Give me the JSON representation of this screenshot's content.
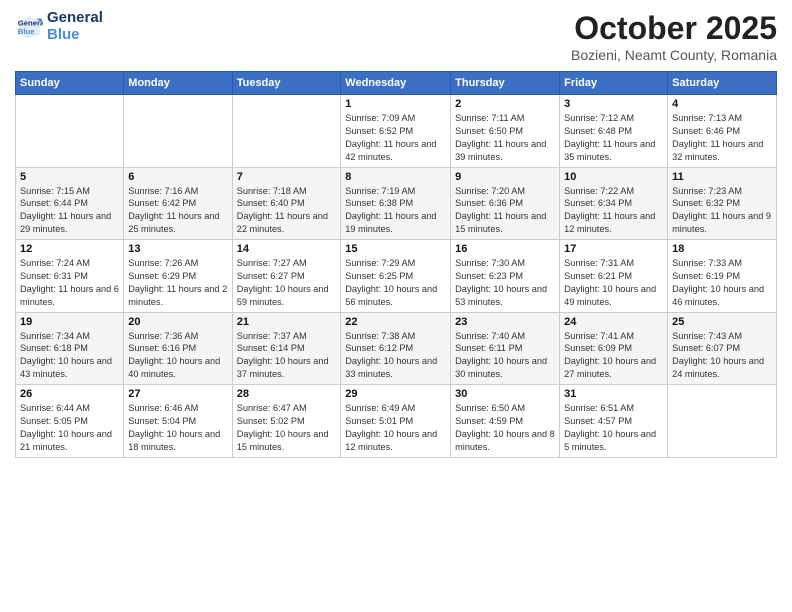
{
  "logo": {
    "line1": "General",
    "line2": "Blue"
  },
  "title": "October 2025",
  "subtitle": "Bozieni, Neamt County, Romania",
  "days_of_week": [
    "Sunday",
    "Monday",
    "Tuesday",
    "Wednesday",
    "Thursday",
    "Friday",
    "Saturday"
  ],
  "weeks": [
    [
      {
        "day": "",
        "sunrise": "",
        "sunset": "",
        "daylight": ""
      },
      {
        "day": "",
        "sunrise": "",
        "sunset": "",
        "daylight": ""
      },
      {
        "day": "",
        "sunrise": "",
        "sunset": "",
        "daylight": ""
      },
      {
        "day": "1",
        "sunrise": "Sunrise: 7:09 AM",
        "sunset": "Sunset: 6:52 PM",
        "daylight": "Daylight: 11 hours and 42 minutes."
      },
      {
        "day": "2",
        "sunrise": "Sunrise: 7:11 AM",
        "sunset": "Sunset: 6:50 PM",
        "daylight": "Daylight: 11 hours and 39 minutes."
      },
      {
        "day": "3",
        "sunrise": "Sunrise: 7:12 AM",
        "sunset": "Sunset: 6:48 PM",
        "daylight": "Daylight: 11 hours and 35 minutes."
      },
      {
        "day": "4",
        "sunrise": "Sunrise: 7:13 AM",
        "sunset": "Sunset: 6:46 PM",
        "daylight": "Daylight: 11 hours and 32 minutes."
      }
    ],
    [
      {
        "day": "5",
        "sunrise": "Sunrise: 7:15 AM",
        "sunset": "Sunset: 6:44 PM",
        "daylight": "Daylight: 11 hours and 29 minutes."
      },
      {
        "day": "6",
        "sunrise": "Sunrise: 7:16 AM",
        "sunset": "Sunset: 6:42 PM",
        "daylight": "Daylight: 11 hours and 25 minutes."
      },
      {
        "day": "7",
        "sunrise": "Sunrise: 7:18 AM",
        "sunset": "Sunset: 6:40 PM",
        "daylight": "Daylight: 11 hours and 22 minutes."
      },
      {
        "day": "8",
        "sunrise": "Sunrise: 7:19 AM",
        "sunset": "Sunset: 6:38 PM",
        "daylight": "Daylight: 11 hours and 19 minutes."
      },
      {
        "day": "9",
        "sunrise": "Sunrise: 7:20 AM",
        "sunset": "Sunset: 6:36 PM",
        "daylight": "Daylight: 11 hours and 15 minutes."
      },
      {
        "day": "10",
        "sunrise": "Sunrise: 7:22 AM",
        "sunset": "Sunset: 6:34 PM",
        "daylight": "Daylight: 11 hours and 12 minutes."
      },
      {
        "day": "11",
        "sunrise": "Sunrise: 7:23 AM",
        "sunset": "Sunset: 6:32 PM",
        "daylight": "Daylight: 11 hours and 9 minutes."
      }
    ],
    [
      {
        "day": "12",
        "sunrise": "Sunrise: 7:24 AM",
        "sunset": "Sunset: 6:31 PM",
        "daylight": "Daylight: 11 hours and 6 minutes."
      },
      {
        "day": "13",
        "sunrise": "Sunrise: 7:26 AM",
        "sunset": "Sunset: 6:29 PM",
        "daylight": "Daylight: 11 hours and 2 minutes."
      },
      {
        "day": "14",
        "sunrise": "Sunrise: 7:27 AM",
        "sunset": "Sunset: 6:27 PM",
        "daylight": "Daylight: 10 hours and 59 minutes."
      },
      {
        "day": "15",
        "sunrise": "Sunrise: 7:29 AM",
        "sunset": "Sunset: 6:25 PM",
        "daylight": "Daylight: 10 hours and 56 minutes."
      },
      {
        "day": "16",
        "sunrise": "Sunrise: 7:30 AM",
        "sunset": "Sunset: 6:23 PM",
        "daylight": "Daylight: 10 hours and 53 minutes."
      },
      {
        "day": "17",
        "sunrise": "Sunrise: 7:31 AM",
        "sunset": "Sunset: 6:21 PM",
        "daylight": "Daylight: 10 hours and 49 minutes."
      },
      {
        "day": "18",
        "sunrise": "Sunrise: 7:33 AM",
        "sunset": "Sunset: 6:19 PM",
        "daylight": "Daylight: 10 hours and 46 minutes."
      }
    ],
    [
      {
        "day": "19",
        "sunrise": "Sunrise: 7:34 AM",
        "sunset": "Sunset: 6:18 PM",
        "daylight": "Daylight: 10 hours and 43 minutes."
      },
      {
        "day": "20",
        "sunrise": "Sunrise: 7:36 AM",
        "sunset": "Sunset: 6:16 PM",
        "daylight": "Daylight: 10 hours and 40 minutes."
      },
      {
        "day": "21",
        "sunrise": "Sunrise: 7:37 AM",
        "sunset": "Sunset: 6:14 PM",
        "daylight": "Daylight: 10 hours and 37 minutes."
      },
      {
        "day": "22",
        "sunrise": "Sunrise: 7:38 AM",
        "sunset": "Sunset: 6:12 PM",
        "daylight": "Daylight: 10 hours and 33 minutes."
      },
      {
        "day": "23",
        "sunrise": "Sunrise: 7:40 AM",
        "sunset": "Sunset: 6:11 PM",
        "daylight": "Daylight: 10 hours and 30 minutes."
      },
      {
        "day": "24",
        "sunrise": "Sunrise: 7:41 AM",
        "sunset": "Sunset: 6:09 PM",
        "daylight": "Daylight: 10 hours and 27 minutes."
      },
      {
        "day": "25",
        "sunrise": "Sunrise: 7:43 AM",
        "sunset": "Sunset: 6:07 PM",
        "daylight": "Daylight: 10 hours and 24 minutes."
      }
    ],
    [
      {
        "day": "26",
        "sunrise": "Sunrise: 6:44 AM",
        "sunset": "Sunset: 5:05 PM",
        "daylight": "Daylight: 10 hours and 21 minutes."
      },
      {
        "day": "27",
        "sunrise": "Sunrise: 6:46 AM",
        "sunset": "Sunset: 5:04 PM",
        "daylight": "Daylight: 10 hours and 18 minutes."
      },
      {
        "day": "28",
        "sunrise": "Sunrise: 6:47 AM",
        "sunset": "Sunset: 5:02 PM",
        "daylight": "Daylight: 10 hours and 15 minutes."
      },
      {
        "day": "29",
        "sunrise": "Sunrise: 6:49 AM",
        "sunset": "Sunset: 5:01 PM",
        "daylight": "Daylight: 10 hours and 12 minutes."
      },
      {
        "day": "30",
        "sunrise": "Sunrise: 6:50 AM",
        "sunset": "Sunset: 4:59 PM",
        "daylight": "Daylight: 10 hours and 8 minutes."
      },
      {
        "day": "31",
        "sunrise": "Sunrise: 6:51 AM",
        "sunset": "Sunset: 4:57 PM",
        "daylight": "Daylight: 10 hours and 5 minutes."
      },
      {
        "day": "",
        "sunrise": "",
        "sunset": "",
        "daylight": ""
      }
    ]
  ]
}
